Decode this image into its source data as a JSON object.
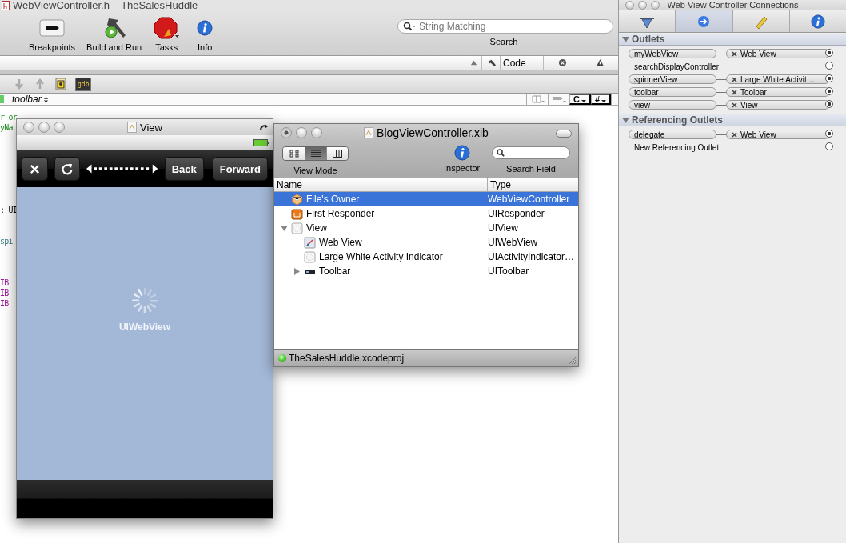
{
  "editor_window": {
    "title": "WebViewController.h – TheSalesHuddle",
    "toolbar": [
      {
        "kind": "breakpoints",
        "label": "Breakpoints"
      },
      {
        "kind": "build",
        "label": "Build and Run"
      },
      {
        "kind": "tasks",
        "label": "Tasks"
      },
      {
        "kind": "info",
        "label": "Info"
      }
    ],
    "search": {
      "placeholder": "String Matching",
      "label": "Search"
    },
    "columns": [
      {
        "kind": "sort"
      },
      {
        "kind": "build"
      },
      {
        "kind": "text",
        "label": "Code"
      },
      {
        "kind": "errors"
      },
      {
        "kind": "warnings"
      }
    ],
    "debug_tools": [
      {
        "kind": "step-down"
      },
      {
        "kind": "step-up"
      },
      {
        "kind": "console"
      },
      {
        "kind": "gdb",
        "label": "gdb"
      }
    ],
    "navigator": {
      "symbol": "toolbar",
      "menus": [
        "C",
        "#"
      ]
    },
    "code_fragments": [
      [
        {
          "kind": "comment",
          "text": "r or"
        },
        {
          "kind": "comment",
          "text": "yNa"
        }
      ],
      [
        {
          "kind": "plain",
          "text": ": UI"
        }
      ],
      [
        {
          "kind": "ivar",
          "text": "spi"
        }
      ],
      [
        {
          "kind": "keyword",
          "text": "IB"
        },
        {
          "kind": "keyword",
          "text": "IB"
        },
        {
          "kind": "keyword",
          "text": "IB"
        }
      ]
    ]
  },
  "view_window": {
    "title": "View",
    "toolbar": [
      {
        "kind": "stop"
      },
      {
        "kind": "refresh"
      },
      {
        "kind": "flexible-space"
      },
      {
        "kind": "button",
        "label": "Back"
      },
      {
        "kind": "button",
        "label": "Forward"
      }
    ],
    "content_label": "UIWebView"
  },
  "xib_window": {
    "title": "BlogViewController.xib",
    "view_modes": [
      {
        "kind": "icons",
        "selected": false
      },
      {
        "kind": "list",
        "selected": true
      },
      {
        "kind": "columns",
        "selected": false
      }
    ],
    "view_mode_label": "View Mode",
    "inspector_label": "Inspector",
    "search_label": "Search Field",
    "table": {
      "columns": [
        "Name",
        "Type"
      ],
      "rows": [
        {
          "kind": "owner",
          "name": "File's Owner",
          "type": "WebViewController",
          "selected": true
        },
        {
          "kind": "responder",
          "name": "First Responder",
          "type": "UIResponder",
          "selected": false
        },
        {
          "kind": "view",
          "name": "View",
          "type": "UIView",
          "selected": false,
          "expanded": true,
          "children": [
            {
              "kind": "webview",
              "name": "Web View",
              "type": "UIWebView",
              "selected": false
            },
            {
              "kind": "activity",
              "name": "Large White Activity Indicator",
              "type": "UIActivityIndicator…",
              "selected": false
            },
            {
              "kind": "toolbar",
              "name": "Toolbar",
              "type": "UIToolbar",
              "selected": false,
              "expanded": false
            }
          ]
        }
      ]
    },
    "status": "TheSalesHuddle.xcodeproj"
  },
  "connections_panel": {
    "title": "Web View Controller Connections",
    "tabs": [
      {
        "kind": "attributes",
        "selected": false
      },
      {
        "kind": "connections",
        "selected": true
      },
      {
        "kind": "size",
        "selected": false
      },
      {
        "kind": "identity",
        "selected": false
      }
    ],
    "sections": [
      {
        "title": "Outlets",
        "expanded": true,
        "rows": [
          {
            "name": "myWebView",
            "target": "Web View",
            "connected": true
          },
          {
            "name": "searchDisplayController",
            "connected": false
          },
          {
            "name": "spinnerView",
            "target": "Large White Activit…",
            "connected": true
          },
          {
            "name": "toolbar",
            "target": "Toolbar",
            "connected": true
          },
          {
            "name": "view",
            "target": "View",
            "connected": true
          }
        ]
      },
      {
        "title": "Referencing Outlets",
        "expanded": true,
        "rows": [
          {
            "name": "delegate",
            "target": "Web View",
            "connected": true
          },
          {
            "name": "New Referencing Outlet",
            "connected": false
          }
        ]
      }
    ]
  }
}
